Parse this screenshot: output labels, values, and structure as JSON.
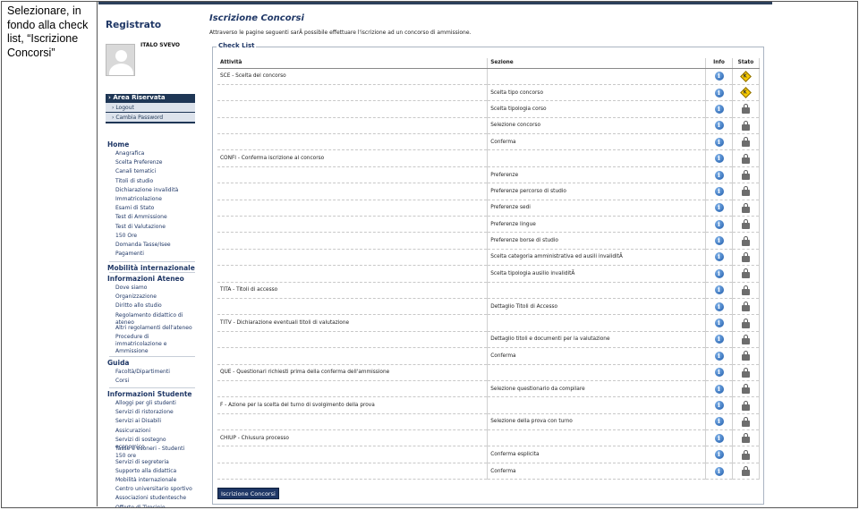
{
  "caption": "Selezionare, in fondo alla check list, “Iscrizione Concorsi”",
  "sidebar": {
    "title": "Registrato",
    "username": "ITALO SVEVO",
    "area": {
      "label": "Area Riservata",
      "items": [
        "Logout",
        "Cambia Password"
      ]
    },
    "sections": [
      {
        "label": "Home",
        "items": [
          "Anagrafica",
          "Scelta Preferenze",
          "Canali tematici",
          "Titoli di studio",
          "Dichiarazione invalidità",
          "Immatricolazione",
          "Esami di Stato",
          "Test di Ammissione",
          "Test di Valutazione",
          "150 Ore",
          "Domanda Tasse/Isee",
          "Pagamenti"
        ]
      },
      {
        "label": "Mobilità internazionale",
        "items": []
      },
      {
        "label": "Informazioni Ateneo",
        "items": [
          "Dove siamo",
          "Organizzazione",
          "Diritto allo studio",
          "Regolamento didattico di ateneo",
          "Altri regolamenti dell'ateneo",
          "Procedure di immatricolazione e Ammissione"
        ]
      },
      {
        "label": "Guida",
        "items": [
          "Facoltà/Dipartimenti",
          "Corsi"
        ]
      },
      {
        "label": "Informazioni Studente",
        "items": [
          "Alloggi per gli studenti",
          "Servizi di ristorazione",
          "Servizi ai Disabili",
          "Assicurazioni",
          "Servizi di sostegno economico",
          "Tasse e esoneri - Studenti 150 ore",
          "Servizi di segreteria",
          "Supporto alla didattica",
          "Mobilità internazionale",
          "Centro universitario sportivo",
          "Associazioni studentesche",
          "Offerte di Tirocinio"
        ]
      }
    ]
  },
  "main": {
    "title": "Iscrizione Concorsi",
    "intro": "Attraverso le pagine seguenti sarÃ  possibile effettuare l'iscrizione ad un concorso di ammissione.",
    "checklist_legend": "Check List",
    "columns": {
      "activity": "Attività",
      "section": "Sezione",
      "info": "Info",
      "status": "Stato"
    },
    "rows": [
      {
        "activity": "SCE - Scelta del concorso",
        "section": "",
        "status": "ok"
      },
      {
        "activity": "",
        "section": "Scelta tipo concorso",
        "status": "ok"
      },
      {
        "activity": "",
        "section": "Scelta tipologia corso",
        "status": "locked"
      },
      {
        "activity": "",
        "section": "Selezione concorso",
        "status": "locked"
      },
      {
        "activity": "",
        "section": "Conferma",
        "status": "locked"
      },
      {
        "activity": "CONFI - Conferma iscrizione al concorso",
        "section": "",
        "status": "locked"
      },
      {
        "activity": "",
        "section": "Preferenze",
        "status": "locked"
      },
      {
        "activity": "",
        "section": "Preferenze percorso di studio",
        "status": "locked"
      },
      {
        "activity": "",
        "section": "Preferenze sedi",
        "status": "locked"
      },
      {
        "activity": "",
        "section": "Preferenze lingue",
        "status": "locked"
      },
      {
        "activity": "",
        "section": "Preferenze borse di studio",
        "status": "locked"
      },
      {
        "activity": "",
        "section": "Scelta categoria amministrativa ed ausili invaliditÃ",
        "status": "locked"
      },
      {
        "activity": "",
        "section": "Scelta tipologia ausilio invaliditÃ",
        "status": "locked"
      },
      {
        "activity": "TITA - Titoli di accesso",
        "section": "",
        "status": "locked"
      },
      {
        "activity": "",
        "section": "Dettaglio Titoli di Accesso",
        "status": "locked"
      },
      {
        "activity": "TITV - Dichiarazione eventuali titoli di valutazione",
        "section": "",
        "status": "locked"
      },
      {
        "activity": "",
        "section": "Dettaglio titoli e documenti per la valutazione",
        "status": "locked"
      },
      {
        "activity": "",
        "section": "Conferma",
        "status": "locked"
      },
      {
        "activity": "QUE - Questionari richiesti prima della conferma dell'ammissione",
        "section": "",
        "status": "locked"
      },
      {
        "activity": "",
        "section": "Selezione questionario da compilare",
        "status": "locked"
      },
      {
        "activity": "F - Azione per la scelta del turno di svolgimento della prova",
        "section": "",
        "status": "locked"
      },
      {
        "activity": "",
        "section": "Selezione della prova con turno",
        "status": "locked"
      },
      {
        "activity": "CHIUP - Chiusura processo",
        "section": "",
        "status": "locked"
      },
      {
        "activity": "",
        "section": "Conferma esplicita",
        "status": "locked"
      },
      {
        "activity": "",
        "section": "Conferma",
        "status": "locked"
      }
    ],
    "button_label": "Iscrizione Concorsi"
  }
}
